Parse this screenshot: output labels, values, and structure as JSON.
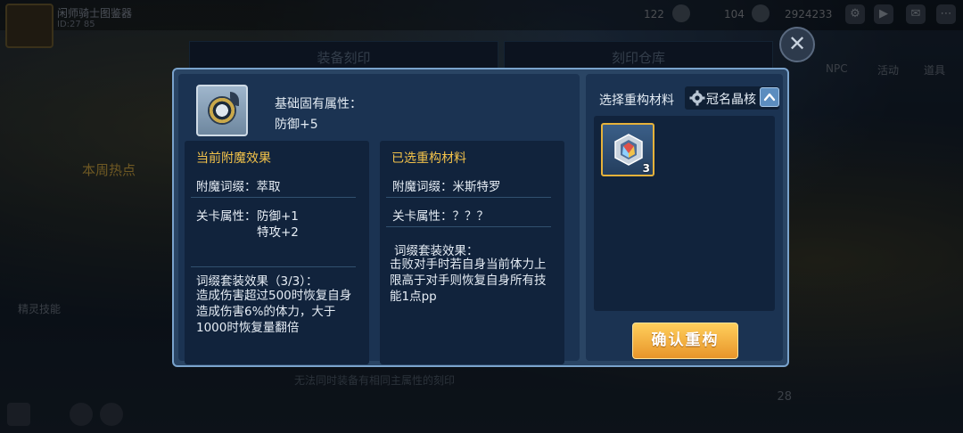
{
  "background": {
    "player": {
      "name": "闲师骑士图鉴器",
      "id_line": "ID:27 85"
    },
    "resources": [
      {
        "icon": "gem-icon",
        "value": "122"
      },
      {
        "icon": "energy-icon",
        "value": "104"
      },
      {
        "icon": "coin-icon",
        "value": "2924233"
      }
    ],
    "tabs": [
      "装备刻印",
      "刻印仓库"
    ],
    "side_labels": {
      "hot": "本周热点",
      "detail": "精灵技能",
      "right1": "NPC",
      "right2": "活动",
      "right3": "道具"
    },
    "hint": "无法同时装备有相同主属性的刻印",
    "page_number": "28"
  },
  "dialog": {
    "base": {
      "title": "基础固有属性：",
      "value": "防御+5"
    },
    "current": {
      "heading": "当前附魔效果",
      "affix": "附魔词缀：萃取",
      "stage_label": "关卡属性：",
      "stage_values": [
        "防御+1",
        "特攻+2"
      ],
      "set_title": "词缀套装效果（3/3）：",
      "set_desc": "造成伤害超过500时恢复自身造成伤害6%的体力，大于1000时恢复量翻倍"
    },
    "selected": {
      "heading": "已选重构材料",
      "affix": "附魔词缀：米斯特罗",
      "stage": "关卡属性：？？？",
      "set_title": "词缀套装效果：",
      "set_desc": "击败对手时若自身当前体力上限高于对手则恢复自身所有技能1点pp"
    },
    "materials": {
      "heading": "选择重构材料",
      "filter_label": "冠名晶核",
      "items": [
        {
          "icon": "crystal-core-icon",
          "count": "3"
        }
      ]
    },
    "confirm_label": "确认重构"
  },
  "colors": {
    "accent_gold": "#f2c24a",
    "panel": "#1b3352",
    "button": "#ffb340"
  }
}
